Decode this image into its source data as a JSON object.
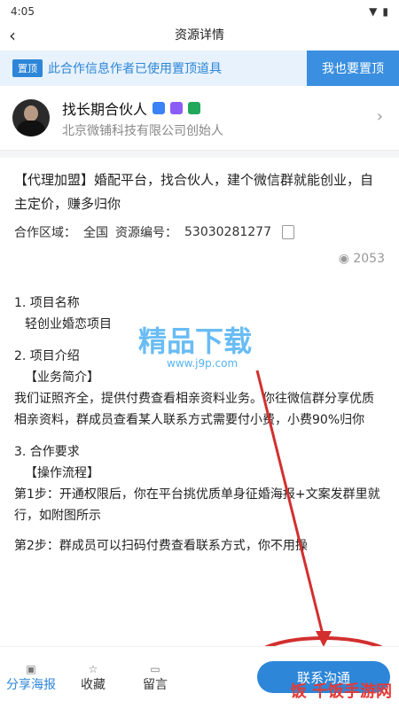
{
  "status": {
    "time": "4:05"
  },
  "nav": {
    "title": "资源详情"
  },
  "promo": {
    "tag": "置顶",
    "text": "此合作信息作者已使用置顶道具",
    "button": "我也要置顶"
  },
  "user": {
    "name": "找长期合伙人",
    "company": "北京微铺科技有限公司创始人"
  },
  "post": {
    "title": "【代理加盟】婚配平台，找合伙人，建个微信群就能创业，自主定价，赚多归你",
    "region_label": "合作区域：",
    "region_value": "全国",
    "resource_id_label": "资源编号：",
    "resource_id_value": "53030281277",
    "views": "2053"
  },
  "sections": {
    "s1_title": "1. 项目名称",
    "s1_body": "轻创业婚恋项目",
    "s2_title": "2. 项目介绍",
    "s2_sub": "【业务简介】",
    "s2_body": "我们证照齐全，提供付费查看相亲资料业务。你往微信群分享优质相亲资料，群成员查看某人联系方式需要付小费，小费90%归你",
    "s3_title": "3. 合作要求",
    "s3_sub": "【操作流程】",
    "s3_step1": "第1步：开通权限后，你在平台挑优质单身征婚海报+文案发群里就行，如附图所示",
    "s3_step2": "第2步：群成员可以扫码付费查看联系方式，你不用操"
  },
  "watermark": {
    "main": "精品下载",
    "sub": "www.j9p.com"
  },
  "bottom": {
    "share": "分享海报",
    "favorite": "收藏",
    "comment": "留言",
    "contact": "联系沟通"
  },
  "logo": {
    "text": "饭 千饭手游网"
  }
}
